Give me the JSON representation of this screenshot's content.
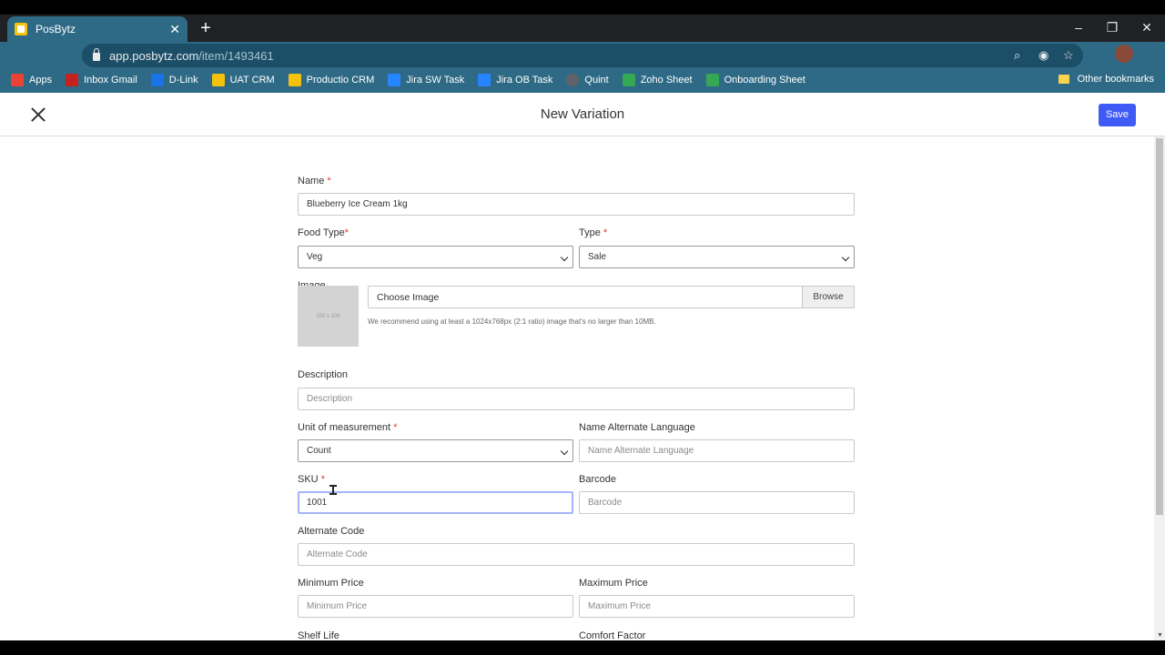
{
  "browser": {
    "tab_title": "PosBytz",
    "url_host": "app.posbytz.com",
    "url_path": "/item/1493461",
    "bookmarks": [
      {
        "label": "Apps",
        "color": "#ea4335"
      },
      {
        "label": "Inbox Gmail",
        "color": "#c5221f"
      },
      {
        "label": "D-Link",
        "color": "#1a73e8"
      },
      {
        "label": "UAT CRM",
        "color": "#f4c20d"
      },
      {
        "label": "Productio CRM",
        "color": "#f4c20d"
      },
      {
        "label": "Jira SW Task",
        "color": "#2684ff"
      },
      {
        "label": "Jira OB Task",
        "color": "#2684ff"
      },
      {
        "label": "Quint",
        "color": "#5f6368"
      },
      {
        "label": "Zoho Sheet",
        "color": "#34a853"
      },
      {
        "label": "Onboarding Sheet",
        "color": "#34a853"
      }
    ],
    "other_bookmarks": "Other bookmarks"
  },
  "header": {
    "title": "New Variation",
    "save_label": "Save"
  },
  "form": {
    "name": {
      "label": "Name",
      "value": "Blueberry Ice Cream 1kg"
    },
    "food_type": {
      "label": "Food Type",
      "value": "Veg"
    },
    "type": {
      "label": "Type",
      "value": "Sale"
    },
    "image": {
      "label": "Image",
      "thumb_text": "100 x 100",
      "choose_text": "Choose Image",
      "browse_label": "Browse",
      "hint": "We recommend using at least a 1024x768px (2:1 ratio) image that's no larger than 10MB."
    },
    "description": {
      "label": "Description",
      "placeholder": "Description"
    },
    "uom": {
      "label": "Unit of measurement",
      "value": "Count"
    },
    "alt_lang": {
      "label": "Name Alternate Language",
      "placeholder": "Name Alternate Language"
    },
    "sku": {
      "label": "SKU",
      "value": "1001"
    },
    "barcode": {
      "label": "Barcode",
      "placeholder": "Barcode"
    },
    "alt_code": {
      "label": "Alternate Code",
      "placeholder": "Alternate Code"
    },
    "min_price": {
      "label": "Minimum Price",
      "placeholder": "Minimum Price"
    },
    "max_price": {
      "label": "Maximum Price",
      "placeholder": "Maximum Price"
    },
    "shelf_life": {
      "label": "Shelf Life"
    },
    "comfort_factor": {
      "label": "Comfort Factor"
    },
    "required_mark": "*"
  },
  "colors": {
    "browser_chrome": "#2e6a85",
    "save_button": "#3f5bf6",
    "required": "#e53935"
  }
}
